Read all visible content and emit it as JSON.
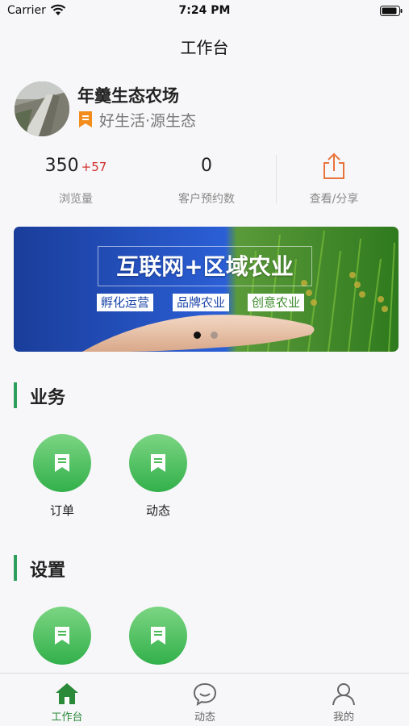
{
  "status_bar": {
    "carrier": "Carrier",
    "time": "7:24 PM"
  },
  "nav": {
    "title": "工作台"
  },
  "profile": {
    "name": "年羹生态农场",
    "slogan": "好生活·源生态"
  },
  "stats": {
    "views": {
      "value": "350",
      "delta": "+57",
      "label": "浏览量"
    },
    "bookings": {
      "value": "0",
      "label": "客户预约数"
    },
    "share": {
      "label": "查看/分享",
      "icon": "share-icon",
      "color": "#e8743b"
    }
  },
  "banner": {
    "headline": "互联网+区域农业",
    "tags": [
      "孵化运营",
      "品牌农业",
      "创意农业"
    ],
    "active_page": 1,
    "page_count": 2
  },
  "sections": {
    "business": {
      "title": "业务",
      "tiles": [
        {
          "label": "订单",
          "icon": "bookmark-icon"
        },
        {
          "label": "动态",
          "icon": "bookmark-icon"
        }
      ]
    },
    "settings": {
      "title": "设置",
      "tiles": [
        {
          "icon": "bookmark-icon"
        },
        {
          "icon": "bookmark-icon"
        }
      ]
    }
  },
  "tabbar": {
    "items": [
      {
        "label": "工作台",
        "icon": "home-icon",
        "active": true
      },
      {
        "label": "动态",
        "icon": "chat-icon",
        "active": false
      },
      {
        "label": "我的",
        "icon": "user-icon",
        "active": false
      }
    ]
  },
  "colors": {
    "accent": "#2e9e5b",
    "delta": "#d0312d",
    "tile_green": "#32b04a"
  }
}
